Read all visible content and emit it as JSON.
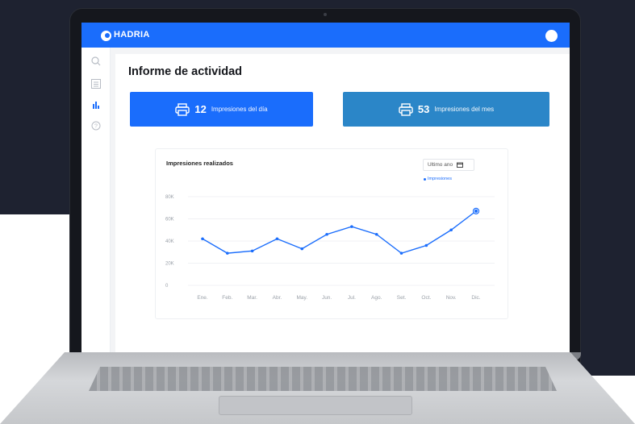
{
  "app": {
    "brand": "HADRIA",
    "page_title": "Informe de actividad"
  },
  "colors": {
    "primary": "#1a6dfc",
    "secondary": "#2b86c8",
    "background_dark": "#1e2230"
  },
  "sidebar": {
    "items": [
      {
        "name": "search",
        "icon": "search-icon"
      },
      {
        "name": "list",
        "icon": "list-icon"
      },
      {
        "name": "reports",
        "icon": "bar-chart-icon",
        "active": true
      },
      {
        "name": "help",
        "icon": "help-icon"
      }
    ]
  },
  "stats": {
    "day": {
      "value": "12",
      "label": "Impresiones del día",
      "icon": "printer-icon"
    },
    "month": {
      "value": "53",
      "label": "Impresiones del mes",
      "icon": "printer-icon"
    }
  },
  "chart": {
    "title": "Impresiones realizados",
    "range_select": "Ultimo ano",
    "legend": "Impresiones"
  },
  "chart_data": {
    "type": "line",
    "title": "Impresiones realizados",
    "categories": [
      "Ene.",
      "Feb.",
      "Mar.",
      "Abr.",
      "May.",
      "Jun.",
      "Jul.",
      "Ago.",
      "Set.",
      "Oct.",
      "Nov.",
      "Dic."
    ],
    "series": [
      {
        "name": "Impresiones",
        "values": [
          42000,
          29000,
          31000,
          42000,
          33000,
          46000,
          53000,
          46000,
          29000,
          36000,
          50000,
          67000
        ]
      }
    ],
    "y_ticks": [
      "0",
      "20K",
      "40K",
      "60K",
      "80K"
    ],
    "ylim": [
      0,
      80000
    ],
    "grid": true,
    "legend_position": "top-right"
  }
}
